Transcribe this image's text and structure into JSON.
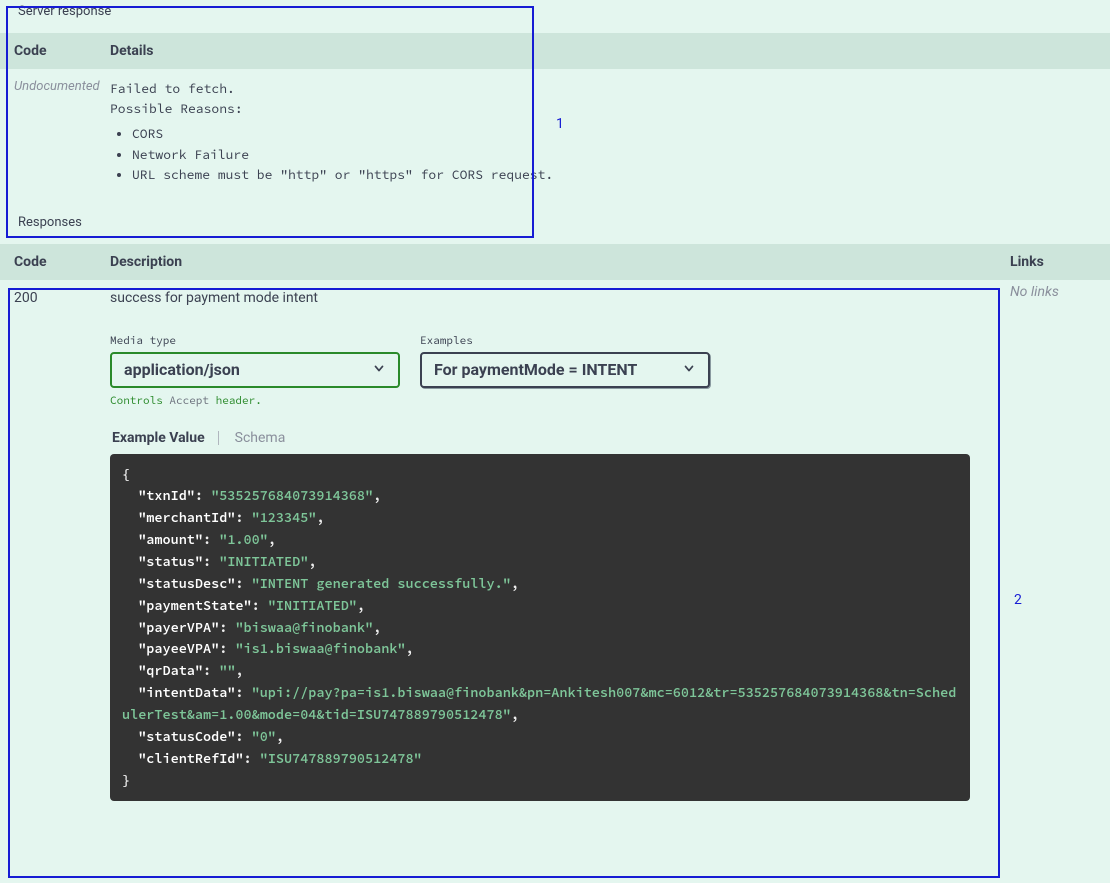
{
  "server_response": {
    "title": "Server response",
    "headers": {
      "code": "Code",
      "details": "Details"
    },
    "row": {
      "code": "Undocumented",
      "message": "Failed to fetch.",
      "reasons_label": "Possible Reasons",
      "reasons": [
        "CORS",
        "Network Failure",
        "URL scheme must be \"http\" or \"https\" for CORS request."
      ]
    }
  },
  "responses": {
    "title": "Responses",
    "headers": {
      "code": "Code",
      "description": "Description",
      "links": "Links"
    },
    "row": {
      "code": "200",
      "description": "success for payment mode intent",
      "media_type_label": "Media type",
      "media_type_value": "application/json",
      "hint_a": "Controls ",
      "hint_accept": "Accept",
      "hint_b": " header.",
      "examples_label": "Examples",
      "examples_value": "For paymentMode = INTENT",
      "tab_example": "Example Value",
      "tab_schema": "Schema",
      "links_value": "No links",
      "example_json": {
        "txnId": "535257684073914368",
        "merchantId": "123345",
        "amount": "1.00",
        "status": "INITIATED",
        "statusDesc": "INTENT generated successfully.",
        "paymentState": "INITIATED",
        "payerVPA": "biswaa@finobank",
        "payeeVPA": "is1.biswaa@finobank",
        "qrData": "",
        "intentData": "upi://pay?pa=is1.biswaa@finobank&pn=Ankitesh007&mc=6012&tr=535257684073914368&tn=SchedulerTest&am=1.00&mode=04&tid=ISU747889790512478",
        "statusCode": "0",
        "clientRefId": "ISU747889790512478"
      }
    }
  },
  "annotations": {
    "box1": "1",
    "box2": "2"
  }
}
